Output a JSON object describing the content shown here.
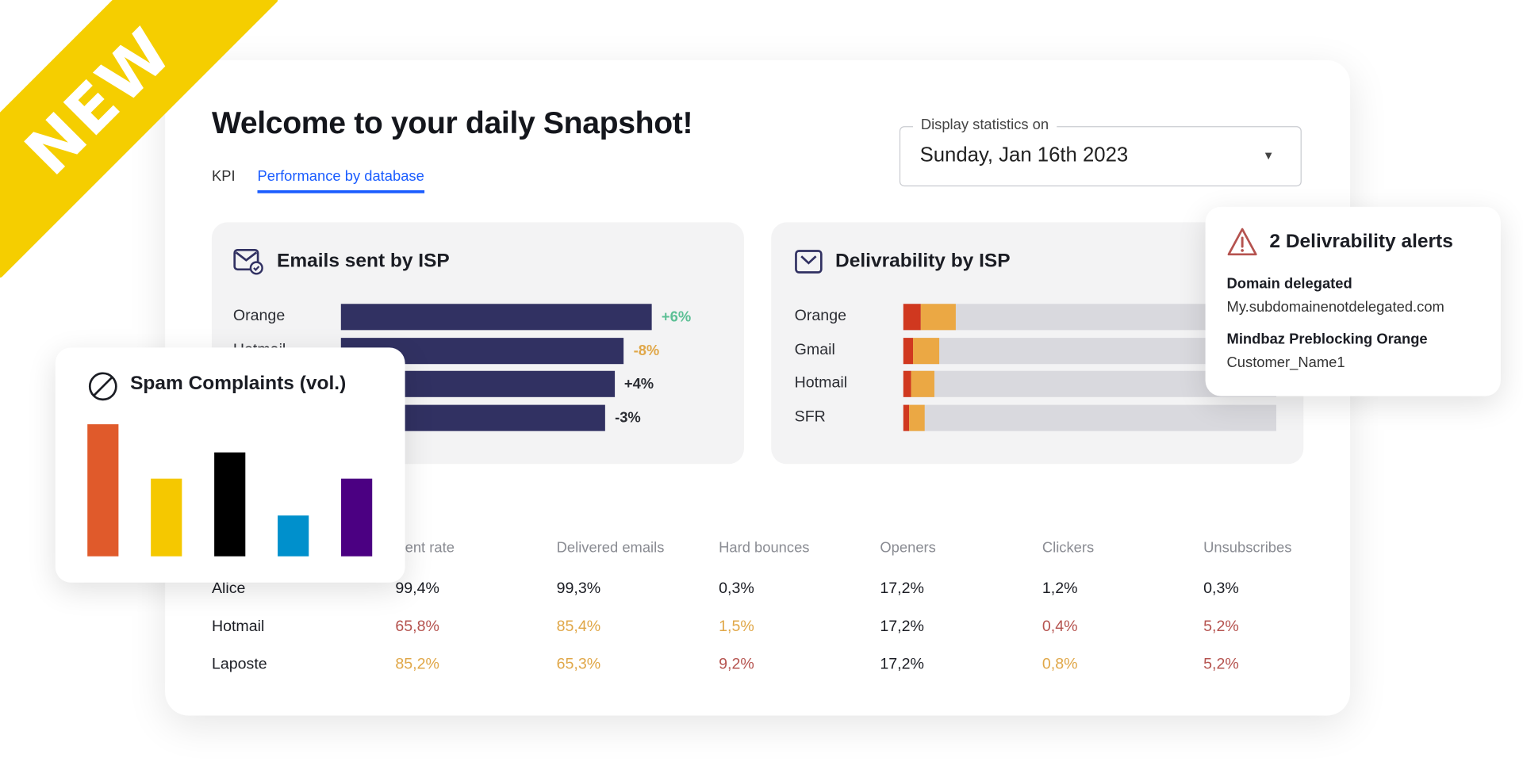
{
  "banner": {
    "label": "NEW",
    "color": "#F5CE00"
  },
  "header": {
    "title": "Welcome to your daily Snapshot!"
  },
  "tabs": [
    {
      "label": "KPI",
      "active": false
    },
    {
      "label": "Performance by database",
      "active": true
    }
  ],
  "date_select": {
    "legend": "Display statistics on",
    "value": "Sunday, Jan 16th 2023"
  },
  "emails_by_isp": {
    "title": "Emails sent by ISP",
    "bar_color": "#313162",
    "rows": [
      {
        "label": "Orange",
        "relative_volume": 100,
        "change": "+6%",
        "change_color": "#5bbf94"
      },
      {
        "label": "Hotmail",
        "relative_volume": 91,
        "change": "-8%",
        "change_color": "#e0a748"
      },
      {
        "label": "",
        "relative_volume": 88,
        "change": "+4%",
        "change_color": "#2b2d33"
      },
      {
        "label": "",
        "relative_volume": 85,
        "change": "-3%",
        "change_color": "#2b2d33"
      }
    ]
  },
  "deliverability_by_isp": {
    "title": "Delivrability by ISP",
    "colors": {
      "red": "#d0381f",
      "orange": "#eba844",
      "track": "#d9d9de"
    },
    "rows": [
      {
        "label": "Orange",
        "red_pct": 4.7,
        "orange_pct": 9.4
      },
      {
        "label": "Gmail",
        "red_pct": 2.6,
        "orange_pct": 7.1
      },
      {
        "label": "Hotmail",
        "red_pct": 2.1,
        "orange_pct": 6.3
      },
      {
        "label": "SFR",
        "red_pct": 1.6,
        "orange_pct": 4.2
      }
    ]
  },
  "alerts": {
    "title": "2 Delivrability alerts",
    "items": [
      {
        "title": "Domain delegated",
        "detail": "My.subdomainenotdelegated.com"
      },
      {
        "title": "Mindbaz Preblocking Orange",
        "detail": "Customer_Name1"
      }
    ]
  },
  "spam_complaints": {
    "title": "Spam Complaints (vol.)",
    "chart_data": {
      "type": "bar",
      "title": "Spam Complaints (vol.)",
      "values": [
        136,
        80,
        107,
        42,
        80
      ],
      "colors": [
        "#E05A2B",
        "#F5C800",
        "#000000",
        "#0090CC",
        "#4B0082"
      ]
    }
  },
  "table": {
    "headers": [
      "Sent rate",
      "Delivered emails",
      "Hard bounces",
      "Openers",
      "Clickers",
      "Unsubscribes"
    ],
    "rows": [
      {
        "name": "Alice",
        "cells": [
          {
            "v": "99,4%",
            "c": "#1b1d24"
          },
          {
            "v": "99,3%",
            "c": "#1b1d24"
          },
          {
            "v": "0,3%",
            "c": "#1b1d24"
          },
          {
            "v": "17,2%",
            "c": "#1b1d24"
          },
          {
            "v": "1,2%",
            "c": "#1b1d24"
          },
          {
            "v": "0,3%",
            "c": "#1b1d24"
          }
        ]
      },
      {
        "name": "Hotmail",
        "cells": [
          {
            "v": "65,8%",
            "c": "#b5534f"
          },
          {
            "v": "85,4%",
            "c": "#e0a748"
          },
          {
            "v": "1,5%",
            "c": "#e0a748"
          },
          {
            "v": "17,2%",
            "c": "#1b1d24"
          },
          {
            "v": "0,4%",
            "c": "#b5534f"
          },
          {
            "v": "5,2%",
            "c": "#b5534f"
          }
        ]
      },
      {
        "name": "Laposte",
        "cells": [
          {
            "v": "85,2%",
            "c": "#e0a748"
          },
          {
            "v": "65,3%",
            "c": "#e0a748"
          },
          {
            "v": "9,2%",
            "c": "#b5534f"
          },
          {
            "v": "17,2%",
            "c": "#1b1d24"
          },
          {
            "v": "0,8%",
            "c": "#e0a748"
          },
          {
            "v": "5,2%",
            "c": "#b5534f"
          }
        ]
      }
    ]
  }
}
